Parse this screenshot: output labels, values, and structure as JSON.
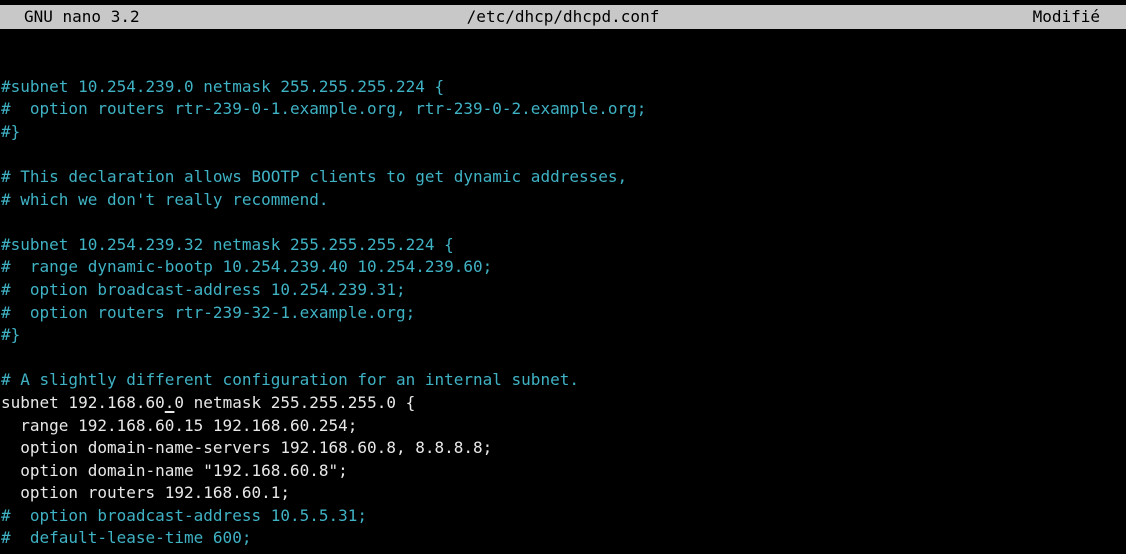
{
  "titlebar": {
    "app_name": "GNU nano 3.2",
    "file_path": "/etc/dhcp/dhcpd.conf",
    "status": "Modifié"
  },
  "colors": {
    "background": "#000000",
    "titlebar_bg": "#c8c8c8",
    "comment": "#3fb2c4",
    "code": "#e8e8e8"
  },
  "editor": {
    "lines": [
      "",
      "#subnet 10.254.239.0 netmask 255.255.255.224 {",
      "#  option routers rtr-239-0-1.example.org, rtr-239-0-2.example.org;",
      "#}",
      "",
      "# This declaration allows BOOTP clients to get dynamic addresses,",
      "# which we don't really recommend.",
      "",
      "#subnet 10.254.239.32 netmask 255.255.255.224 {",
      "#  range dynamic-bootp 10.254.239.40 10.254.239.60;",
      "#  option broadcast-address 10.254.239.31;",
      "#  option routers rtr-239-32-1.example.org;",
      "#}",
      "",
      "# A slightly different configuration for an internal subnet.",
      "subnet 192.168.60.0 netmask 255.255.255.0 {",
      "  range 192.168.60.15 192.168.60.254;",
      "  option domain-name-servers 192.168.60.8, 8.8.8.8;",
      "  option domain-name \"192.168.60.8\";",
      "  option routers 192.168.60.1;",
      "#  option broadcast-address 10.5.5.31;",
      "#  default-lease-time 600;"
    ],
    "cursor": {
      "line": 15,
      "column": 17
    }
  }
}
